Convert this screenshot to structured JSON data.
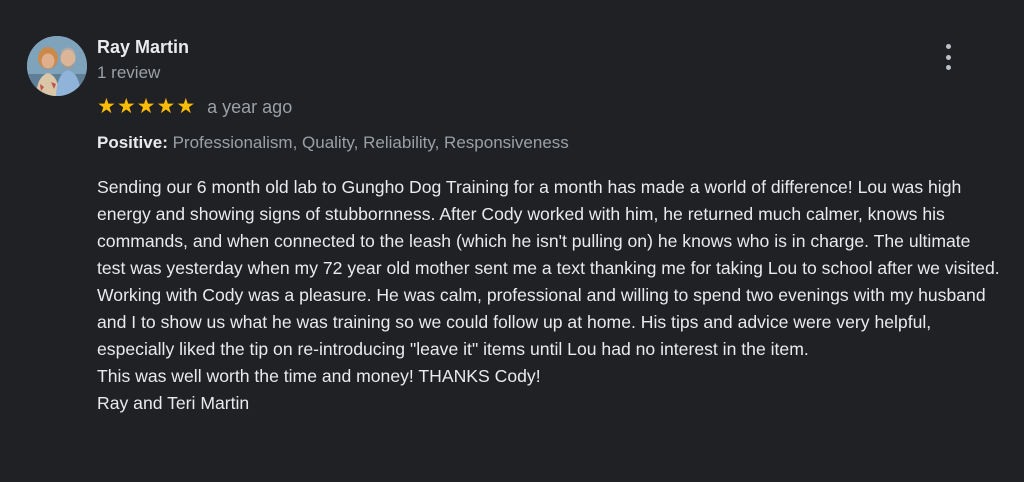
{
  "reviewer": {
    "name": "Ray Martin",
    "review_count": "1 review",
    "avatar_icon": "reviewer-photo"
  },
  "menu_icon": "more-vert-icon",
  "rating": {
    "stars": 5,
    "star_glyph": "★",
    "star_color": "#fbbc04",
    "time_ago": "a year ago"
  },
  "attributes": {
    "label": "Positive:",
    "values": "Professionalism, Quality, Reliability, Responsiveness"
  },
  "review_text": [
    "Sending our 6 month old lab to Gungho Dog Training for a month has made a world of difference!  Lou was high energy and showing signs of stubbornness.  After Cody worked with him, he returned much calmer, knows his commands, and when connected to the leash (which he isn't pulling on) he knows who is in charge.  The ultimate test was yesterday when my 72 year old mother sent me a text thanking me for taking Lou to school after we visited.",
    "Working with Cody was a pleasure.  He was calm, professional and willing to spend two evenings with my husband and I to show us what he was training so we could follow up at home. His tips and advice were very helpful, especially liked the tip on re-introducing \"leave it\" items until Lou had no interest in the item.",
    "This was well worth the time and money!  THANKS Cody!",
    "Ray and Teri Martin"
  ],
  "colors": {
    "background": "#202124",
    "primary_text": "#e8eaed",
    "secondary_text": "#9aa0a6"
  }
}
